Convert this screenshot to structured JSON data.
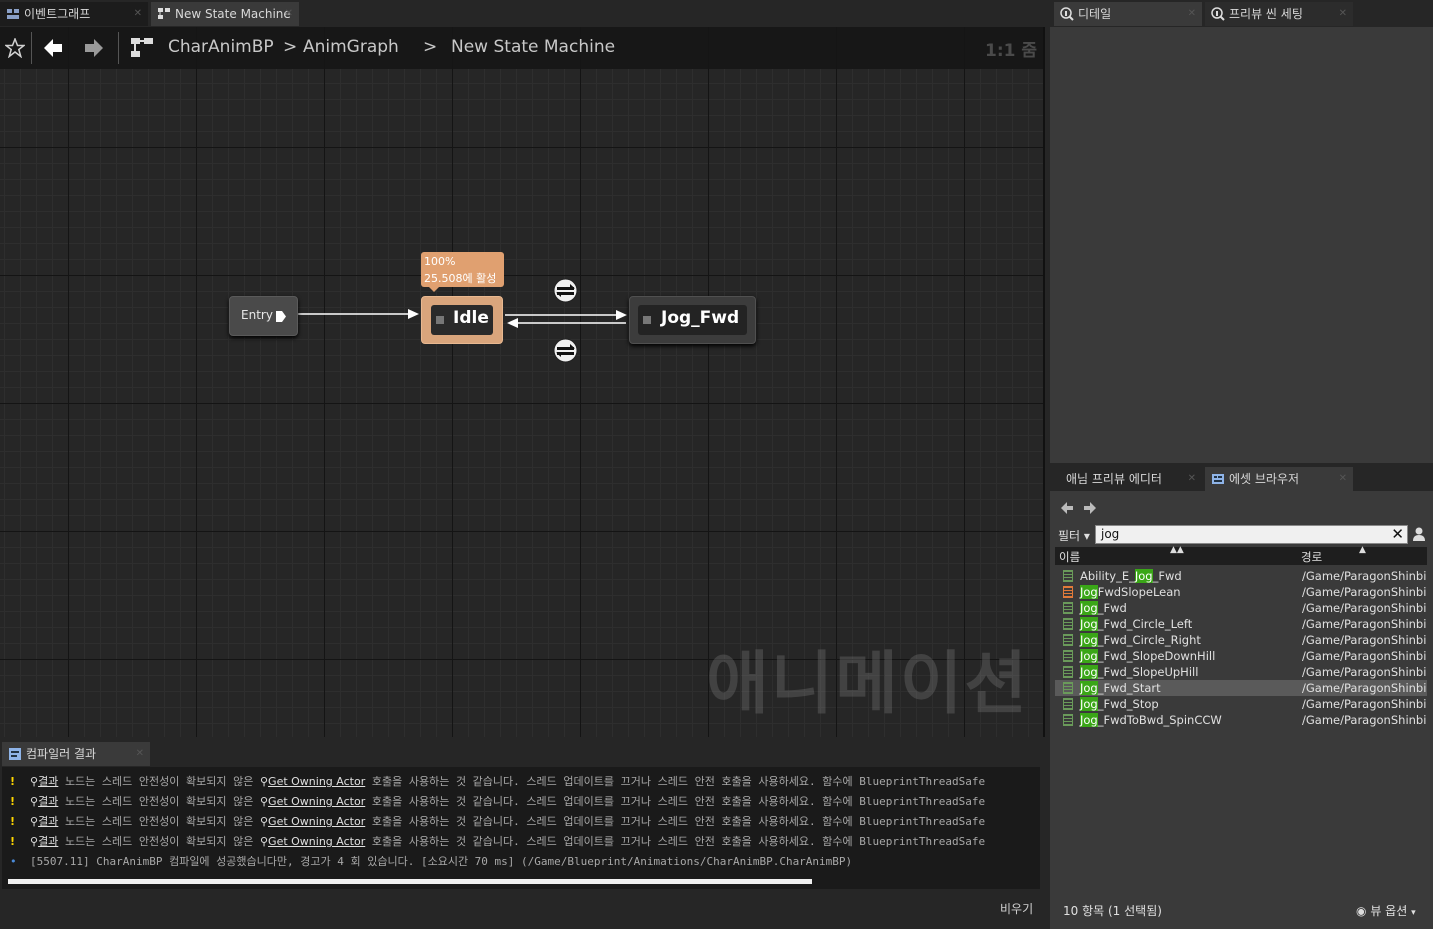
{
  "tabs": {
    "left": [
      {
        "label": "이벤트그래프",
        "active": false
      },
      {
        "label": "New State Machine",
        "active": true
      }
    ],
    "right_top": [
      {
        "label": "디테일",
        "active": true
      },
      {
        "label": "프리뷰 씬 세팅",
        "active": false
      }
    ],
    "right_bottom": [
      {
        "label": "애님 프리뷰 에디터",
        "active": false
      },
      {
        "label": "에셋 브라우저",
        "active": true
      }
    ],
    "compiler": {
      "label": "컴파일러 결과"
    }
  },
  "breadcrumb": {
    "items": [
      "CharAnimBP",
      "AnimGraph",
      "New State Machine"
    ],
    "separator": ">"
  },
  "graph": {
    "zoom": "1:1 줌",
    "watermark": "애니메이션",
    "nodes": {
      "entry": {
        "label": "Entry"
      },
      "idle": {
        "label": "Idle",
        "tooltip_line1": "100%",
        "tooltip_line2": "25.508에 활성"
      },
      "jog": {
        "label": "Jog_Fwd"
      }
    }
  },
  "compiler_log": {
    "warnings": [
      {
        "result": "결과",
        "msg1": "노드는 스레드 안전성이 확보되지 않은",
        "link": "Get Owning Actor",
        "msg2": "호출을 사용하는 것 같습니다. 스레드 업데이트를 끄거나 스레드 안전 호출을 사용하세요. 함수에 BlueprintThreadSafe"
      },
      {
        "result": "결과",
        "msg1": "노드는 스레드 안전성이 확보되지 않은",
        "link": "Get Owning Actor",
        "msg2": "호출을 사용하는 것 같습니다. 스레드 업데이트를 끄거나 스레드 안전 호출을 사용하세요. 함수에 BlueprintThreadSafe"
      },
      {
        "result": "결과",
        "msg1": "노드는 스레드 안전성이 확보되지 않은",
        "link": "Get Owning Actor",
        "msg2": "호출을 사용하는 것 같습니다. 스레드 업데이트를 끄거나 스레드 안전 호출을 사용하세요. 함수에 BlueprintThreadSafe"
      },
      {
        "result": "결과",
        "msg1": "노드는 스레드 안전성이 확보되지 않은",
        "link": "Get Owning Actor",
        "msg2": "호출을 사용하는 것 같습니다. 스레드 업데이트를 끄거나 스레드 안전 호출을 사용하세요. 함수에 BlueprintThreadSafe"
      }
    ],
    "info": "[5507.11] CharAnimBP 컴파일에 성공했습니다만, 경고가 4 회 있습니다. [소요시간 70 ms] (/Game/Blueprint/Animations/CharAnimBP.CharAnimBP)",
    "clear_label": "비우기"
  },
  "asset_browser": {
    "filter_label": "필터",
    "search_value": "jog",
    "col_name": "이름",
    "col_path": "경로",
    "rows": [
      {
        "pre": "Ability_E_",
        "match": "Jog",
        "post": "_Fwd",
        "path": "/Game/ParagonShinbi",
        "icon": "animation-sequence-icon",
        "selected": false
      },
      {
        "pre": "",
        "match": "Jog",
        "post": "FwdSlopeLean",
        "path": "/Game/ParagonShinbi",
        "icon": "aim-offset-icon",
        "selected": false
      },
      {
        "pre": "",
        "match": "Jog",
        "post": "_Fwd",
        "path": "/Game/ParagonShinbi",
        "icon": "animation-sequence-icon",
        "selected": false
      },
      {
        "pre": "",
        "match": "Jog",
        "post": "_Fwd_Circle_Left",
        "path": "/Game/ParagonShinbi",
        "icon": "animation-sequence-icon",
        "selected": false
      },
      {
        "pre": "",
        "match": "Jog",
        "post": "_Fwd_Circle_Right",
        "path": "/Game/ParagonShinbi",
        "icon": "animation-sequence-icon",
        "selected": false
      },
      {
        "pre": "",
        "match": "Jog",
        "post": "_Fwd_SlopeDownHill",
        "path": "/Game/ParagonShinbi",
        "icon": "animation-sequence-icon",
        "selected": false
      },
      {
        "pre": "",
        "match": "Jog",
        "post": "_Fwd_SlopeUpHill",
        "path": "/Game/ParagonShinbi",
        "icon": "animation-sequence-icon",
        "selected": false
      },
      {
        "pre": "",
        "match": "Jog",
        "post": "_Fwd_Start",
        "path": "/Game/ParagonShinbi",
        "icon": "animation-sequence-icon",
        "selected": true
      },
      {
        "pre": "",
        "match": "Jog",
        "post": "_Fwd_Stop",
        "path": "/Game/ParagonShinbi",
        "icon": "animation-sequence-icon",
        "selected": false
      },
      {
        "pre": "",
        "match": "Jog",
        "post": "_FwdToBwd_SpinCCW",
        "path": "/Game/ParagonShinbi",
        "icon": "animation-sequence-icon",
        "selected": false
      }
    ],
    "status": "10 항목 (1 선택됨)",
    "view_options": "뷰 옵션"
  },
  "colors": {
    "idle_node": "#d9a57c",
    "highlight": "#3aa617",
    "warning": "#ffd700",
    "tooltip": "#e0a070"
  }
}
